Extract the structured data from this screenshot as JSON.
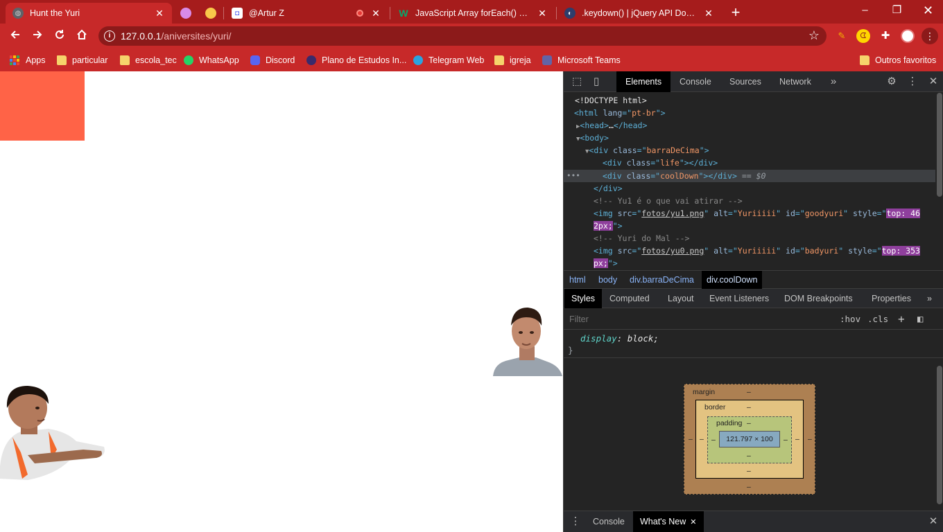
{
  "browser": {
    "tabs": [
      {
        "title": "Hunt the Yuri",
        "favicon": "globe-icon",
        "active": true
      },
      {
        "title": "",
        "favicon": "purple-circle-icon",
        "active": false
      },
      {
        "title": "",
        "favicon": "yellow-circle-icon",
        "active": false
      },
      {
        "title": "@Artur Z",
        "favicon": "discord-icon",
        "active": false
      },
      {
        "title": "JavaScript Array forEach() Method",
        "favicon": "w3schools-icon",
        "active": false
      },
      {
        "title": ".keydown() | jQuery API Documentation",
        "favicon": "jquery-icon",
        "active": false
      }
    ],
    "new_tab": "+",
    "window_controls": {
      "minimize": "–",
      "maximize": "❐",
      "close": "✕"
    },
    "url": {
      "host": "127.0.0.1",
      "path": "/aniversites/yuri/"
    },
    "bookmarks": [
      {
        "label": "Apps",
        "icon": "apps-grid-icon"
      },
      {
        "label": "particular",
        "icon": "folder-icon"
      },
      {
        "label": "escola_tec",
        "icon": "folder-icon"
      },
      {
        "label": "WhatsApp",
        "icon": "whatsapp-icon"
      },
      {
        "label": "Discord",
        "icon": "discord-icon"
      },
      {
        "label": "Plano de Estudos In...",
        "icon": "page-icon"
      },
      {
        "label": "Telegram Web",
        "icon": "telegram-icon"
      },
      {
        "label": "igreja",
        "icon": "folder-icon"
      },
      {
        "label": "Microsoft Teams",
        "icon": "teams-icon"
      }
    ],
    "other_bookmarks": "Outros favoritos"
  },
  "page": {
    "cooldown_color": "#ff6347",
    "good_sprite_alt": "Yuriiiii",
    "bad_sprite_alt": "Yuriiiii"
  },
  "devtools": {
    "tabs": [
      "Elements",
      "Console",
      "Sources",
      "Network"
    ],
    "more": "»",
    "elements": {
      "doctype": "<!DOCTYPE html>",
      "html_lang": "pt-br",
      "head_collapsed": "…",
      "div1_class": "barraDeCima",
      "div2_class": "life",
      "div3_class": "coolDown",
      "selected_marker": "== $0",
      "comment1": "<!-- Yu1 é o que vai atirar -->",
      "img1_src": "fotos/yu1.png",
      "img1_alt": "Yuriiiii",
      "img1_id": "goodyuri",
      "img1_style_a": "top: 46",
      "img1_style_b": "2px;",
      "comment2": "<!-- Yuri do Mal -->",
      "img2_src": "fotos/yu0.png",
      "img2_alt": "Yuriiiii",
      "img2_id": "badyuri",
      "img2_style_a": "top: 353",
      "img2_style_b": "px;"
    },
    "breadcrumbs": [
      "html",
      "body",
      "div.barraDeCima",
      "div.coolDown"
    ],
    "subtabs": [
      "Styles",
      "Computed",
      "Layout",
      "Event Listeners",
      "DOM Breakpoints",
      "Properties"
    ],
    "filter_placeholder": "Filter",
    "hov": ":hov",
    "cls": ".cls",
    "style_rule": {
      "property": "display",
      "value": "block;",
      "close_brace": "}"
    },
    "box_model": {
      "margin_label": "margin",
      "border_label": "border",
      "padding_label": "padding",
      "content": "121.797 × 100",
      "dash": "–"
    },
    "drawer_tabs": [
      "Console",
      "What's New"
    ]
  }
}
